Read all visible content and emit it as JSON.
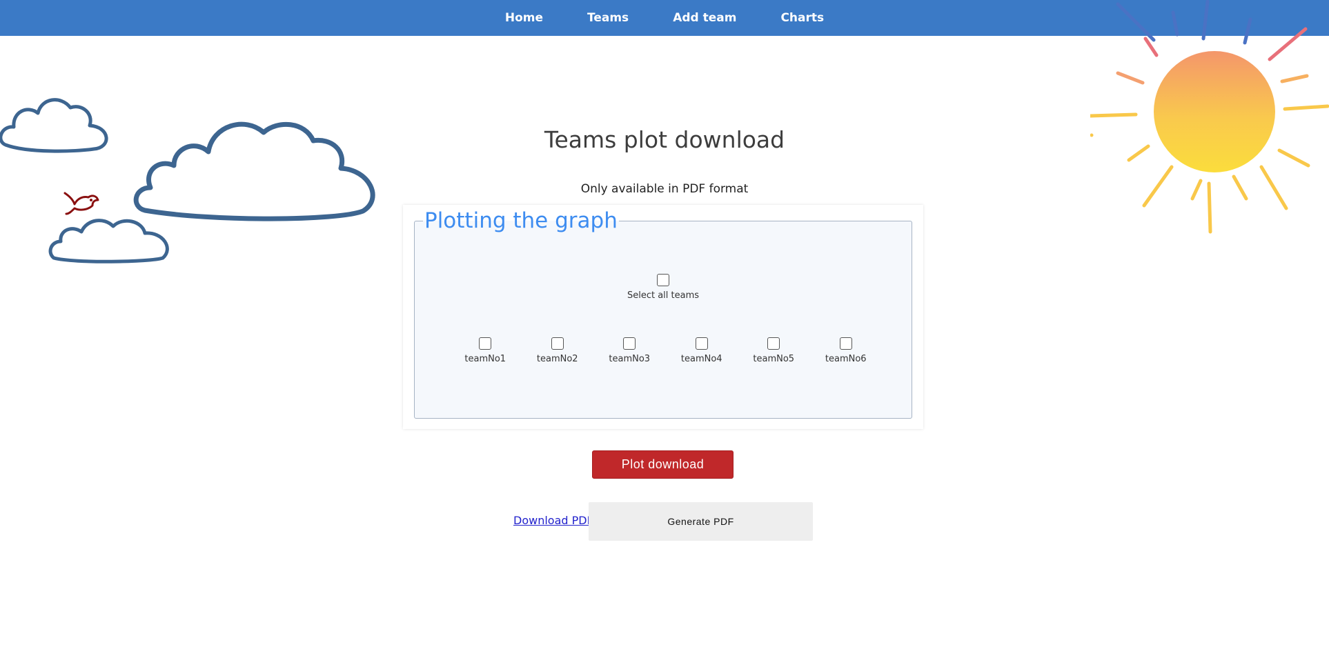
{
  "nav": {
    "items": [
      {
        "label": "Home"
      },
      {
        "label": "Teams"
      },
      {
        "label": "Add team"
      },
      {
        "label": "Charts"
      }
    ],
    "background": "#3b7ac6"
  },
  "page": {
    "title": "Teams plot download",
    "subtitle": "Only available in PDF format"
  },
  "graph_panel": {
    "legend": "Plotting the graph",
    "select_all_label": "Select all teams",
    "teams": [
      {
        "label": "teamNo1",
        "checked": false
      },
      {
        "label": "teamNo2",
        "checked": false
      },
      {
        "label": "teamNo3",
        "checked": false
      },
      {
        "label": "teamNo4",
        "checked": false
      },
      {
        "label": "teamNo5",
        "checked": false
      },
      {
        "label": "teamNo6",
        "checked": false
      }
    ],
    "legend_color": "#3d8cf0"
  },
  "actions": {
    "plot_download_label": "Plot download",
    "plot_download_color": "#c0282a",
    "download_pdf_link": "Download PDF",
    "generate_pdf_label": "Generate PDF"
  },
  "decorations": {
    "icons": [
      "cloud-icon",
      "bird-icon",
      "sun-icon"
    ]
  }
}
